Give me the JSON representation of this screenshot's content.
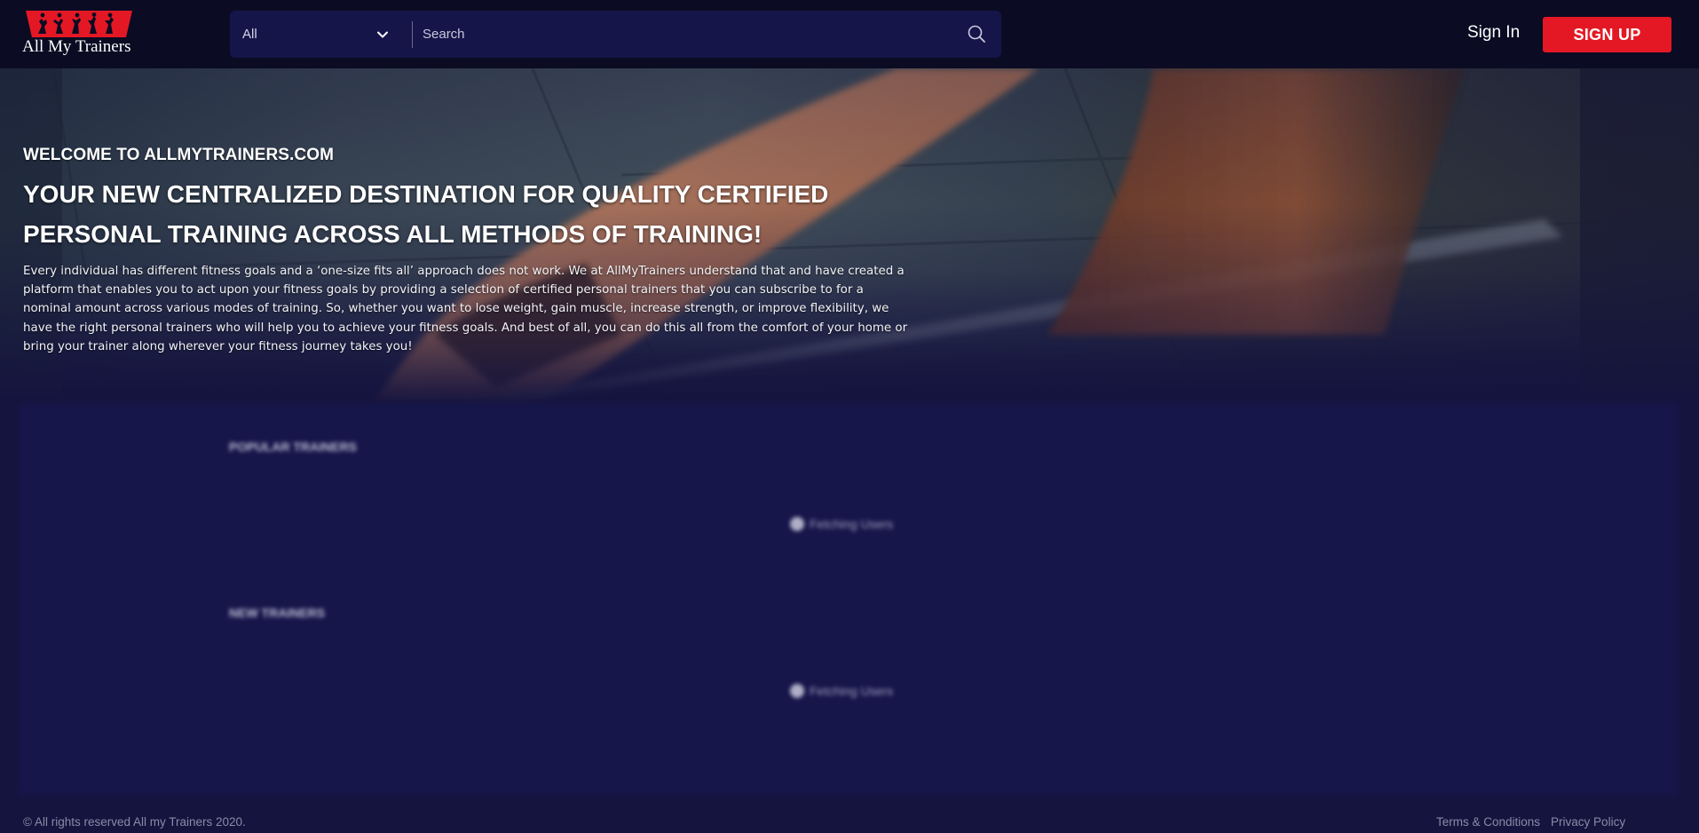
{
  "header": {
    "logo_text": "All My Trainers",
    "search": {
      "category_value": "All",
      "placeholder": "Search"
    },
    "sign_in_label": "Sign In",
    "sign_up_label": "SIGN UP"
  },
  "hero": {
    "eyebrow": "WELCOME TO ALLMYTRAINERS.COM",
    "title": "YOUR NEW CENTRALIZED DESTINATION FOR QUALITY CERTIFIED PERSONAL TRAINING ACROSS ALL METHODS OF TRAINING!",
    "description": "Every individual has different fitness goals and a ‘one-size fits all’ approach does not work. We at AllMyTrainers understand that and have created a platform that enables you to act upon your fitness goals by providing a selection of certified personal trainers that you can subscribe to for a nominal amount across various modes of training. So, whether you want to lose weight, gain muscle, increase strength, or improve flexibility, we have the right personal trainers who will help you to achieve your fitness goals. And best of all, you can do this all from the comfort of your home or bring your trainer along wherever your fitness journey takes you!"
  },
  "sections": {
    "popular": {
      "title": "POPULAR TRAINERS",
      "loading_text": "Fetching Users"
    },
    "new": {
      "title": "NEW TRAINERS",
      "loading_text": "Fetching Users"
    }
  },
  "footer": {
    "copyright": "© All rights reserved All my Trainers 2020.",
    "terms_label": "Terms & Conditions",
    "privacy_label": "Privacy Policy"
  },
  "colors": {
    "brand_red": "#e41824",
    "header_bg": "#0b0b23",
    "page_bg": "#15143f",
    "search_bg": "#16154a"
  },
  "icons": {
    "logo": "silhouettes-logo-icon",
    "dropdown": "chevron-down-icon",
    "search": "search-icon",
    "loading": "spinner-icon"
  }
}
